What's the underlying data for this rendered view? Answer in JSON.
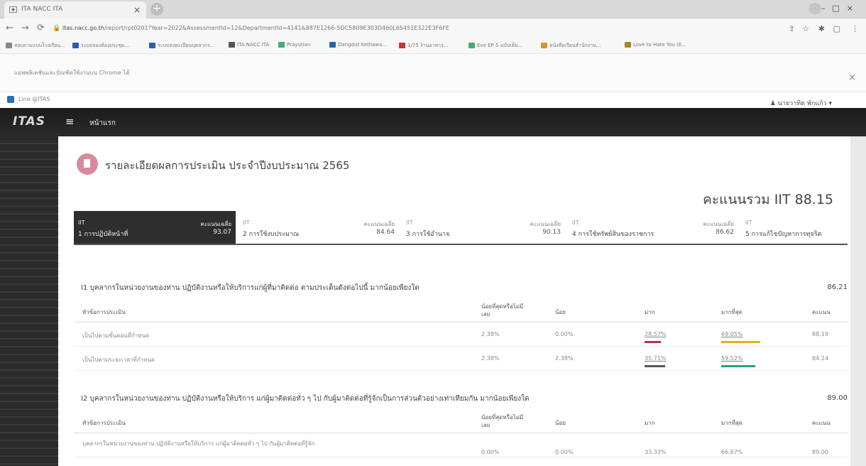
{
  "browser": {
    "tab_title": "ITA NACC ITA",
    "url_host": "itas.nacc.go.th",
    "url_path": "/report/rpt0201?Year=2022&AssessmentId=12&DepartmentId=4141&887E1266-5DC5809E303D460L65451E322E3F6FE",
    "bookmarks": [
      "สอบถามแบบโรงเรียน...",
      "ระบบจองห้องประชุม...",
      "ระบบลงทะเบียนบุคลากร...",
      "ITA NACC ITA",
      "Prayutian",
      "Dangdut Kethawa...",
      "1/75 ร้านอาหาร...",
      "Eve EP 5 ฉบับเต็ม...",
      "หนังสือเวียนสำนักงาน...",
      "Love to Hate You (E..."
    ],
    "info_message": "แอพพลิเคชันและบัณฑิตใช้งานบน Chrome ได้",
    "line_label": "Line @ITAS",
    "user_name": "นายวาทิต พักแก้ว"
  },
  "app": {
    "logo": "ITAS",
    "home_label": "หน้าแรก",
    "page_title": "รายละเอียดผลการประเมิน ประจำปีงบประมาณ 2565",
    "total_score_label": "คะแนนรวม IIT 88.15",
    "avg_label": "คะแนนเฉลี่ย",
    "categories": [
      {
        "code": "IIT",
        "name": "1 การปฏิบัติหน้าที่",
        "avg": "93.07"
      },
      {
        "code": "IIT",
        "name": "2 การใช้งบประมาณ",
        "avg": "84.64"
      },
      {
        "code": "IIT",
        "name": "3 การใช้อำนาจ",
        "avg": "90.13"
      },
      {
        "code": "IIT",
        "name": "4 การใช้ทรัพย์สินของราชการ",
        "avg": "86.62"
      },
      {
        "code": "IIT",
        "name": "5 การแก้ไขปัญหาการทุจริต",
        "avg": ""
      }
    ],
    "columns": {
      "topic": "หัวข้อการประเมิน",
      "least": "น้อยที่สุดหรือไม่มีเลย",
      "little": "น้อย",
      "much": "มาก",
      "most": "มากที่สุด",
      "score": "คะแนน"
    },
    "sections": [
      {
        "title": "I1 บุคลากรในหน่วยงานของท่าน ปฏิบัติงานหรือให้บริการแก่ผู้ที่มาติดต่อ ตามประเด็นดังต่อไปนี้ มากน้อยเพียงใด",
        "score": "86.21",
        "rows": [
          {
            "topic": "เป็นไปตามขั้นตอนที่กำหนด",
            "least": "2.38%",
            "little": "0.00%",
            "much": "28.57%",
            "most": "69.05%",
            "score": "88.19",
            "much_pct": 28.57,
            "most_pct": 69.05
          },
          {
            "topic": "เป็นไปตามระยะเวลาที่กำหนด",
            "least": "2.38%",
            "little": "2.38%",
            "much": "35.71%",
            "most": "59.52%",
            "score": "84.24",
            "much_pct": 35.71,
            "most_pct": 59.52
          }
        ]
      },
      {
        "title": "I2 บุคลากรในหน่วยงานของท่าน ปฏิบัติงานหรือให้บริการ แก่ผู้มาติดต่อทั่ว ๆ ไป กับผู้มาติดต่อที่รู้จักเป็นการส่วนตัวอย่างเท่าเทียมกัน มากน้อยเพียงใด",
        "score": "89.00",
        "rows": [
          {
            "topic": "บุคลากรในหน่วยงานของท่าน ปฏิบัติงานหรือให้บริการ แก่ผู้มาติดต่อทั่ว ๆ ไป กับผู้มาติดต่อที่รู้จัก",
            "least": "0.00%",
            "little": "0.00%",
            "much": "33.33%",
            "most": "66.67%",
            "score": "89.00",
            "much_pct": 33.33,
            "most_pct": 66.67
          }
        ]
      }
    ],
    "colors": {
      "much_bar_1": "#b03060",
      "much_bar_2": "#555555",
      "most_bar_1": "#e0b020",
      "most_bar_2": "#2aa070"
    }
  }
}
